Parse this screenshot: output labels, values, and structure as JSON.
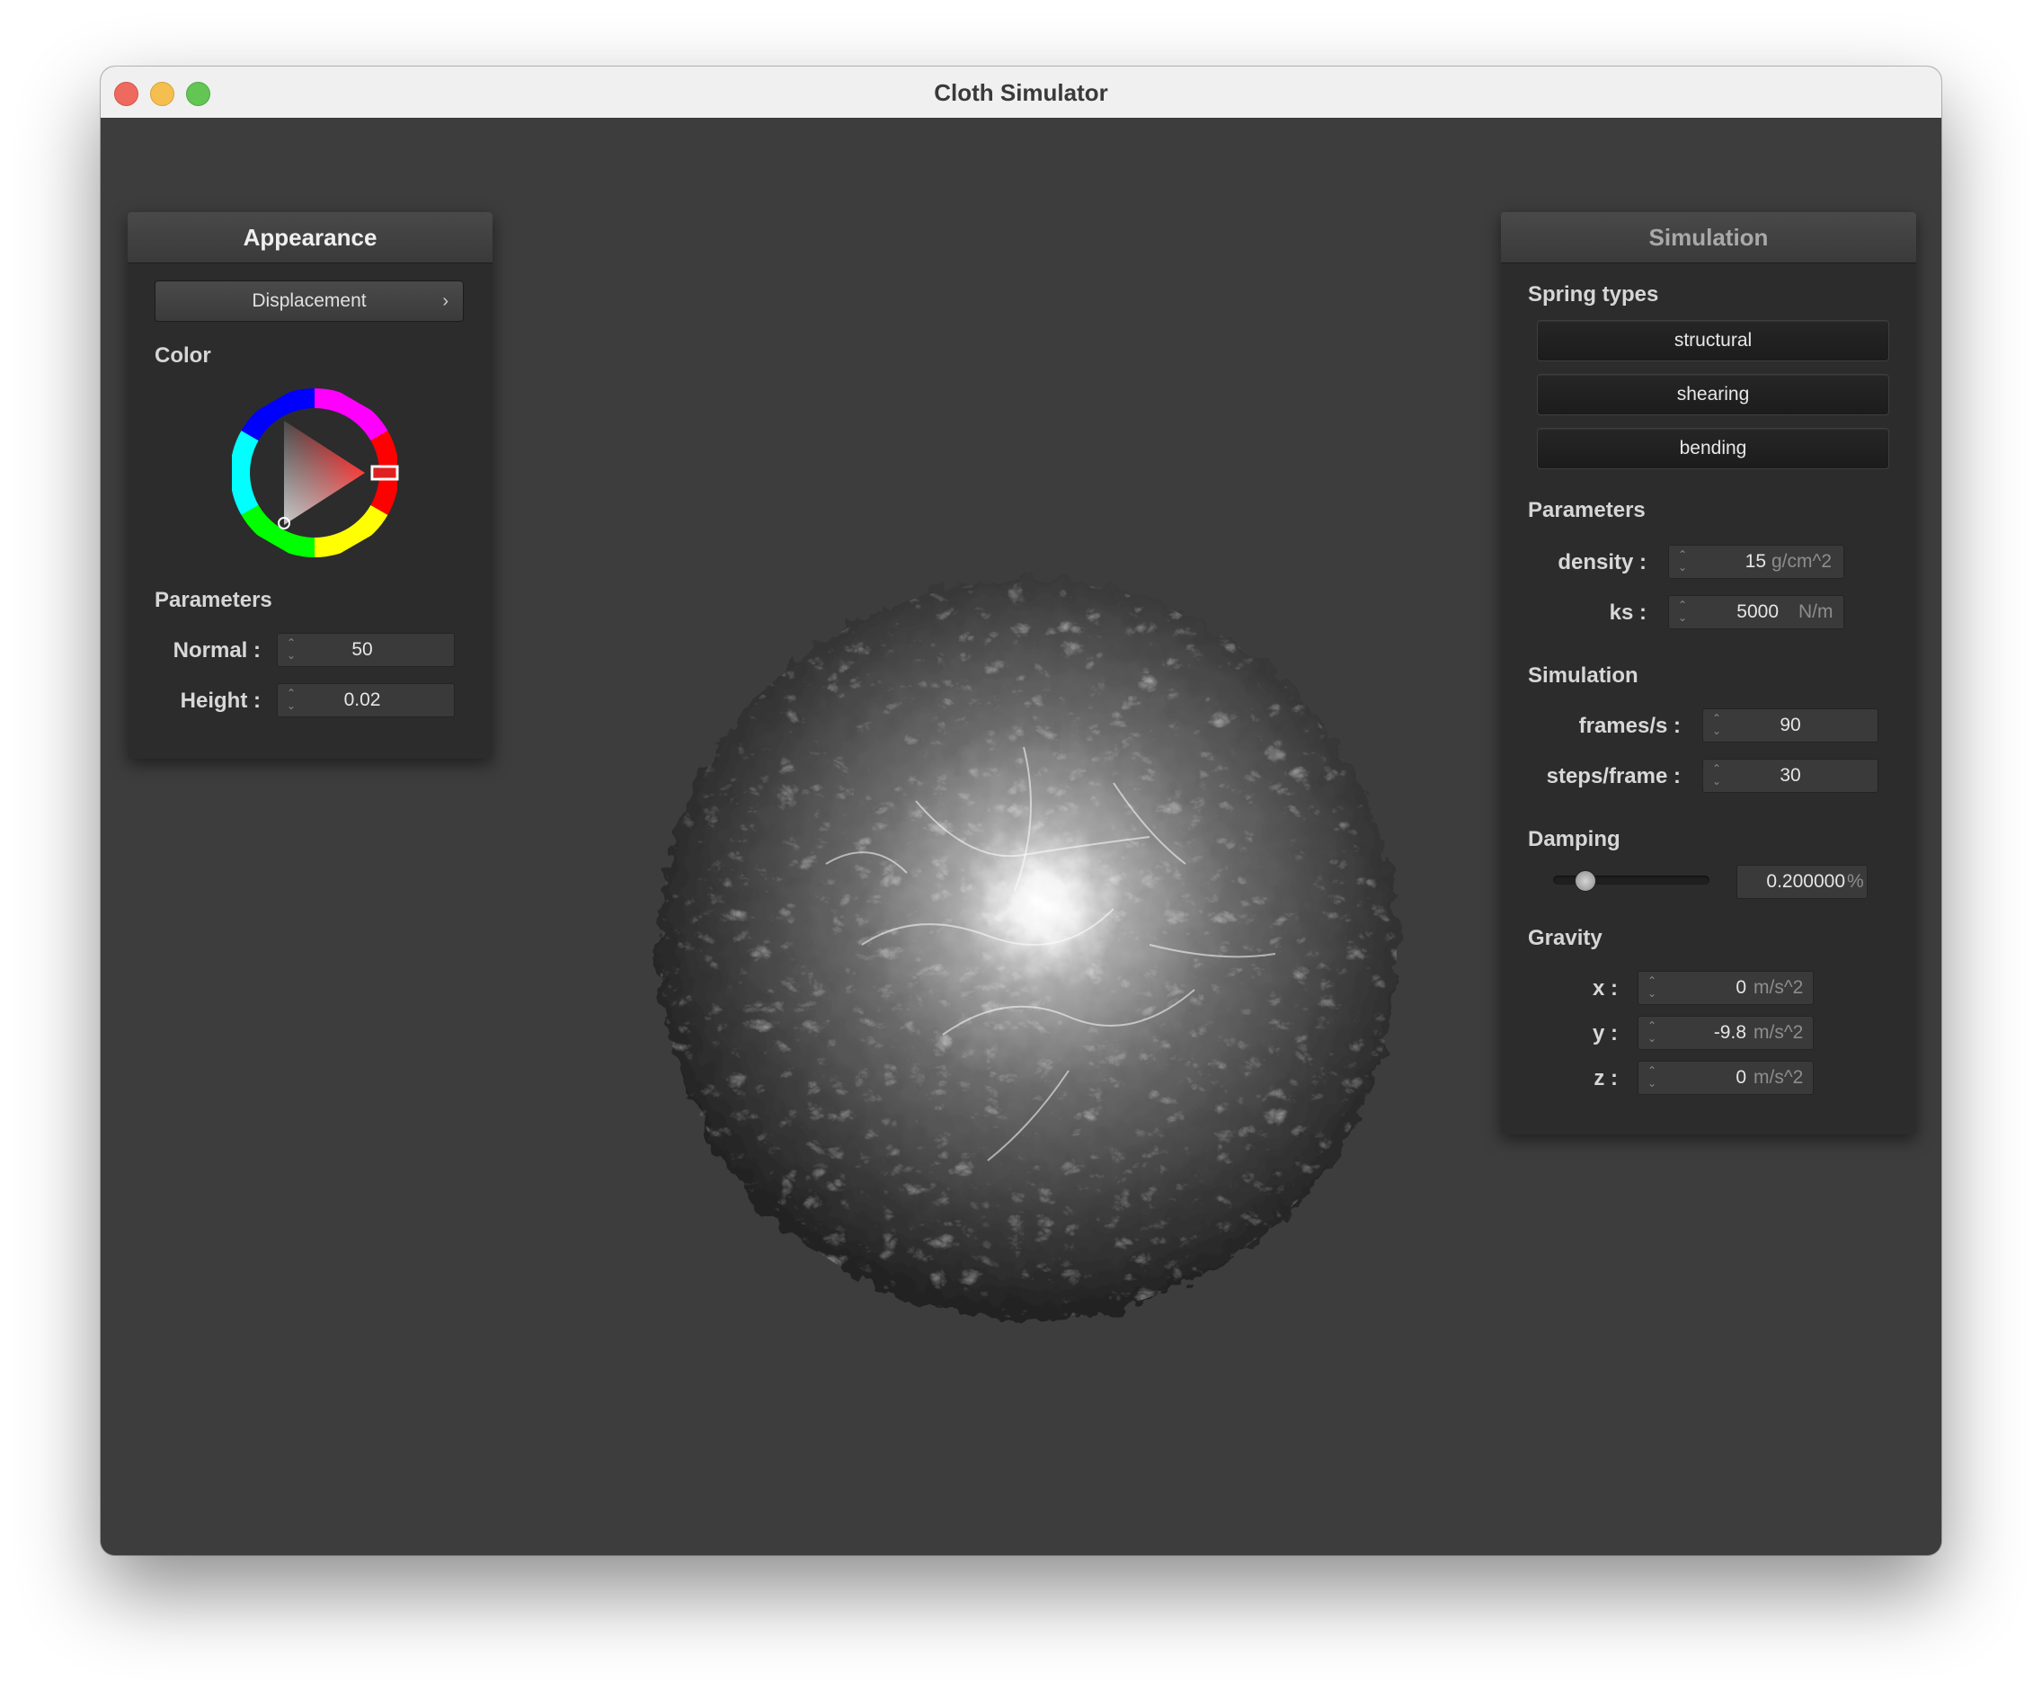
{
  "window": {
    "title": "Cloth Simulator"
  },
  "appearance": {
    "header": "Appearance",
    "shader": "Displacement",
    "color_label": "Color",
    "selected_color": "#ff2020",
    "params_label": "Parameters",
    "normal": {
      "label": "Normal :",
      "value": "50"
    },
    "height": {
      "label": "Height :",
      "value": "0.02"
    }
  },
  "simulation": {
    "header": "Simulation",
    "spring_types_label": "Spring types",
    "springs": [
      "structural",
      "shearing",
      "bending"
    ],
    "params_label": "Parameters",
    "density": {
      "label": "density :",
      "value": "15",
      "unit": "g/cm^2"
    },
    "ks": {
      "label": "ks :",
      "value": "5000",
      "unit": "N/m"
    },
    "sim_label": "Simulation",
    "fps": {
      "label": "frames/s :",
      "value": "90"
    },
    "steps": {
      "label": "steps/frame :",
      "value": "30"
    },
    "damping_label": "Damping",
    "damping": {
      "value": "0.200000",
      "unit": "%",
      "slider_fraction": 0.2
    },
    "gravity_label": "Gravity",
    "gx": {
      "label": "x :",
      "value": "0",
      "unit": "m/s^2"
    },
    "gy": {
      "label": "y :",
      "value": "-9.8",
      "unit": "m/s^2"
    },
    "gz": {
      "label": "z :",
      "value": "0",
      "unit": "m/s^2"
    }
  }
}
